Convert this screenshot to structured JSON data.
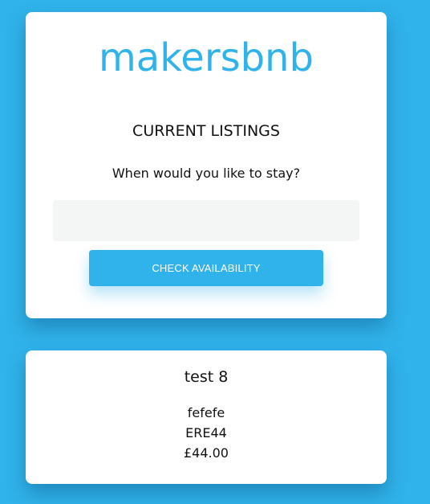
{
  "brand": {
    "logo_text": "makersbnb",
    "accent_color": "#30b3ea"
  },
  "search": {
    "heading": "CURRENT LISTINGS",
    "question": "When would you like to stay?",
    "date_value": "",
    "button_label": "CHECK AVAILABILITY"
  },
  "listings": [
    {
      "name": "test 8",
      "description": "fefefe",
      "code": "ERE44",
      "price": "£44.00"
    }
  ]
}
